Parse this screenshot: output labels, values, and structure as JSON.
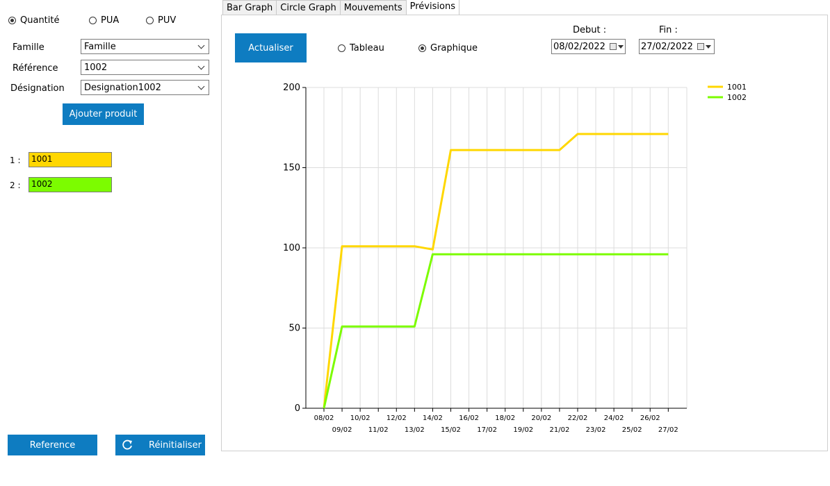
{
  "left": {
    "radios": [
      {
        "label": "Quantité",
        "checked": true
      },
      {
        "label": "PUA",
        "checked": false
      },
      {
        "label": "PUV",
        "checked": false
      }
    ],
    "famille": {
      "label": "Famille",
      "value": "Famille"
    },
    "reference": {
      "label": "Référence",
      "value": "1002"
    },
    "designation": {
      "label": "Désignation",
      "value": "Designation1002"
    },
    "add_button": "Ajouter produit",
    "products": [
      {
        "index": "1 :",
        "value": "1001",
        "color": "#ffd700"
      },
      {
        "index": "2 :",
        "value": "1002",
        "color": "#7cfc00"
      }
    ],
    "reference_button": "Reference",
    "reset_button": "Réinitialiser"
  },
  "tabs": [
    "Bar Graph",
    "Circle Graph",
    "Mouvements",
    "Prévisions"
  ],
  "active_tab": "Prévisions",
  "panel": {
    "refresh_button": "Actualiser",
    "view_radios": [
      {
        "label": "Tableau",
        "checked": false
      },
      {
        "label": "Graphique",
        "checked": true
      }
    ],
    "debut": {
      "label": "Debut :",
      "value": "08/02/2022"
    },
    "fin": {
      "label": "Fin :",
      "value": "27/02/2022"
    }
  },
  "chart_data": {
    "type": "line",
    "x": [
      "08/02",
      "09/02",
      "10/02",
      "11/02",
      "12/02",
      "13/02",
      "14/02",
      "15/02",
      "16/02",
      "17/02",
      "18/02",
      "19/02",
      "20/02",
      "21/02",
      "22/02",
      "23/02",
      "24/02",
      "25/02",
      "26/02",
      "27/02"
    ],
    "series": [
      {
        "name": "1001",
        "color": "#ffd700",
        "values": [
          0,
          101,
          101,
          101,
          101,
          101,
          99,
          161,
          161,
          161,
          161,
          161,
          161,
          161,
          171,
          171,
          171,
          171,
          171,
          171
        ]
      },
      {
        "name": "1002",
        "color": "#7cfc00",
        "values": [
          0,
          51,
          51,
          51,
          51,
          51,
          96,
          96,
          96,
          96,
          96,
          96,
          96,
          96,
          96,
          96,
          96,
          96,
          96,
          96
        ]
      }
    ],
    "yticks": [
      0,
      50,
      100,
      150,
      200
    ],
    "ylim": [
      0,
      200
    ],
    "grid": true,
    "legend": "top-right"
  }
}
